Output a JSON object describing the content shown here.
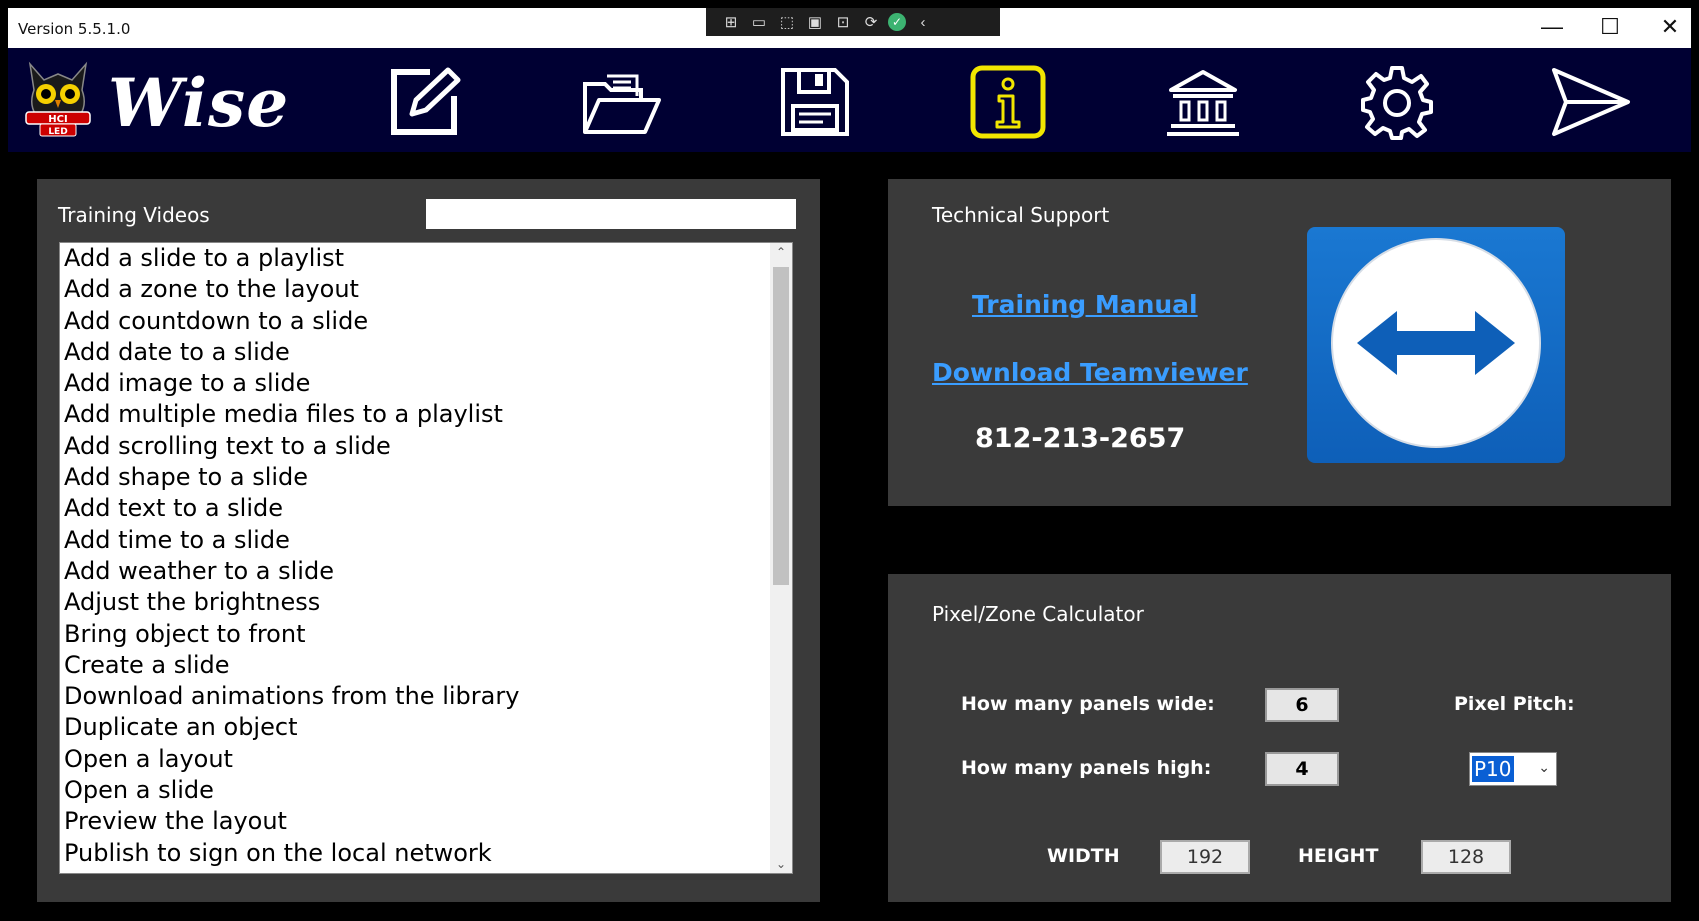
{
  "window": {
    "version_text": "Version 5.5.1.0",
    "controls": {
      "minimize": "—",
      "maximize": "☐",
      "close": "✕"
    }
  },
  "debug_toolbar": {
    "icons": [
      "inspect-icon",
      "record-icon",
      "select-icon",
      "layout-icon",
      "track-icon",
      "hot-reload-icon",
      "ok-icon",
      "collapse-icon"
    ]
  },
  "toolbar": {
    "brand": "Wise",
    "logo_badge": "HCI",
    "logo_sub": "LED",
    "tools": [
      {
        "name": "edit",
        "icon": "edit-icon",
        "active": false
      },
      {
        "name": "open",
        "icon": "folder-open-icon",
        "active": false
      },
      {
        "name": "save",
        "icon": "save-icon",
        "active": false
      },
      {
        "name": "info",
        "icon": "info-icon",
        "active": true
      },
      {
        "name": "library",
        "icon": "library-icon",
        "active": false
      },
      {
        "name": "settings",
        "icon": "gear-icon",
        "active": false
      },
      {
        "name": "publish",
        "icon": "send-icon",
        "active": false
      }
    ],
    "active_color": "#f2e600",
    "bg_color": "#000033"
  },
  "training": {
    "title": "Training Videos",
    "search_value": "",
    "items": [
      "Add a slide to a playlist",
      "Add a zone to the layout",
      "Add countdown to a slide",
      "Add date to a slide",
      "Add image to a slide",
      "Add multiple media files to a playlist",
      "Add scrolling text to a slide",
      "Add shape to a slide",
      "Add text to a slide",
      "Add time to a slide",
      "Add weather to a slide",
      "Adjust the brightness",
      "Bring object to front",
      "Create a slide",
      "Download animations from the library",
      "Duplicate an object",
      "Open a layout",
      "Open a slide",
      "Preview the layout",
      "Publish to sign on the local network"
    ]
  },
  "support": {
    "title": "Technical Support",
    "training_manual": "Training Manual",
    "download_teamviewer": "Download Teamviewer",
    "phone": "812-213-2657",
    "link_color": "#3a9dff"
  },
  "calculator": {
    "title": "Pixel/Zone Calculator",
    "wide_label": "How many panels wide:",
    "wide_value": "6",
    "high_label": "How many panels high:",
    "high_value": "4",
    "pitch_label": "Pixel Pitch:",
    "pitch_value": "P10",
    "width_label": "WIDTH",
    "width_value": "192",
    "height_label": "HEIGHT",
    "height_value": "128"
  }
}
